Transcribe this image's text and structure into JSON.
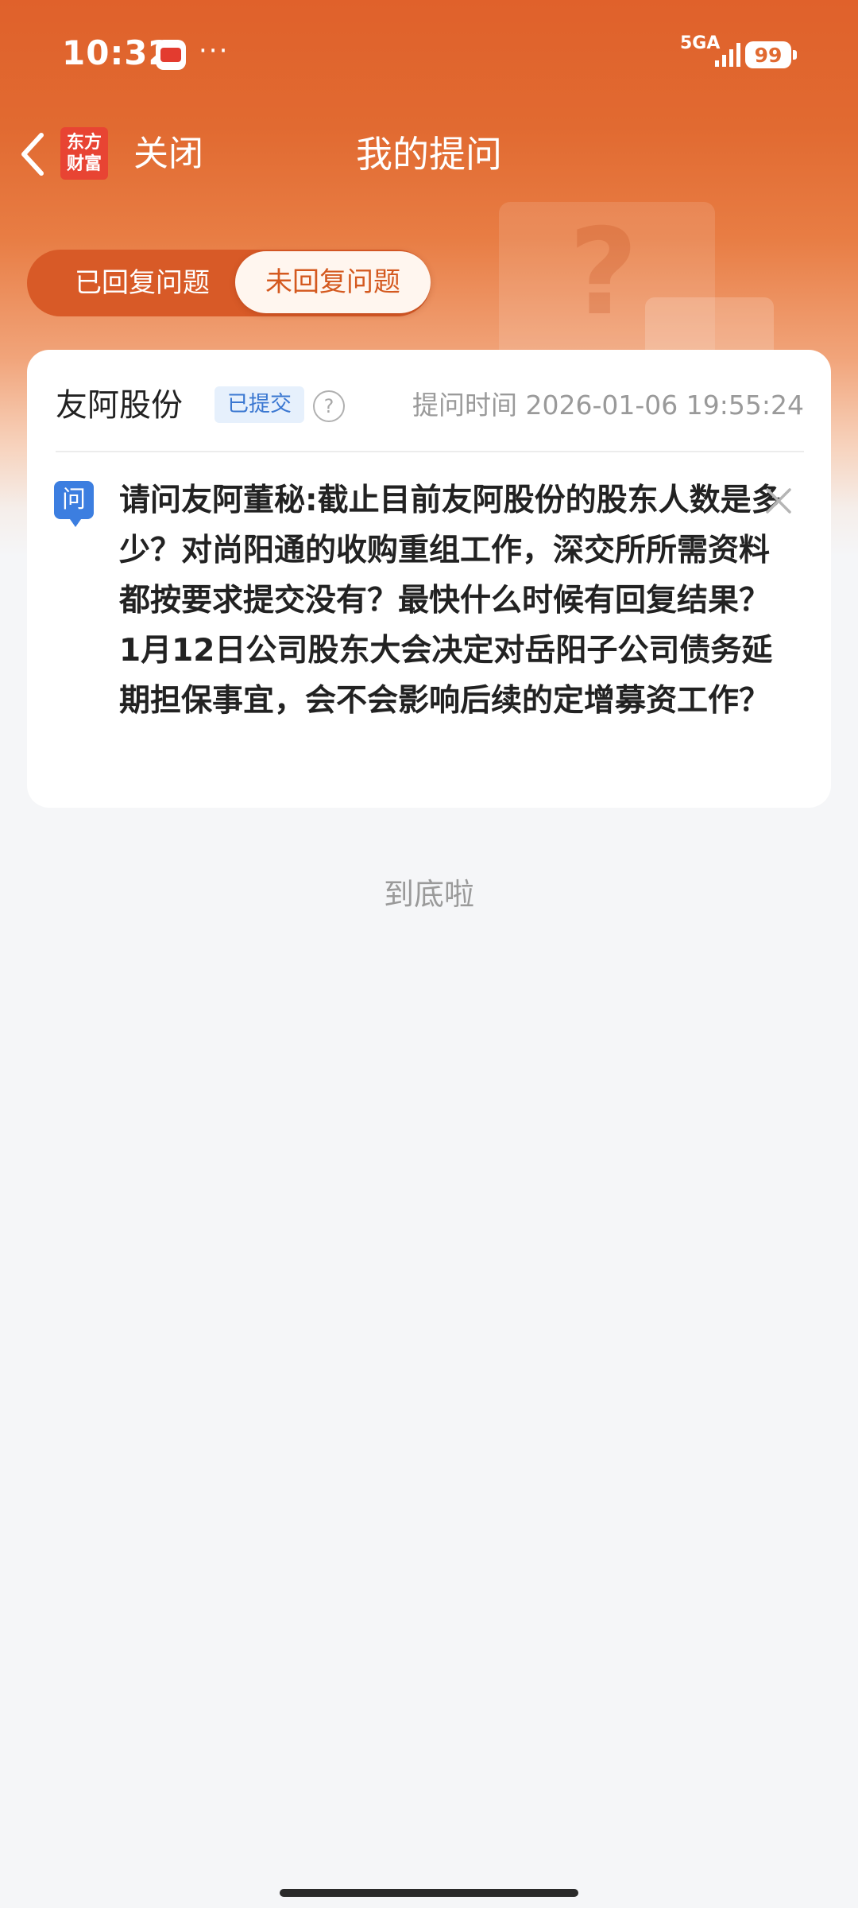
{
  "status_bar": {
    "time": "10:32",
    "more": "···",
    "network": "5GA",
    "battery": "99"
  },
  "nav": {
    "logo_line1": "东方",
    "logo_line2": "财富",
    "close_label": "关闭",
    "title": "我的提问"
  },
  "tabs": {
    "answered": "已回复问题",
    "unanswered": "未回复问题",
    "active": "unanswered"
  },
  "question": {
    "stock_name": "友阿股份",
    "status": "已提交",
    "help": "?",
    "ask_time": "提问时间 2026-01-06 19:55:24",
    "badge": "问",
    "text": "请问友阿董秘:截止目前友阿股份的股东人数是多少？对尚阳通的收购重组工作，深交所所需资料都按要求提交没有？最快什么时候有回复结果？1月12日公司股东大会决定对岳阳子公司债务延期担保事宜，会不会影响后续的定增募资工作？"
  },
  "footer": {
    "end_text": "到底啦"
  },
  "colors": {
    "brand_orange": "#e16a31",
    "badge_blue": "#3c7ee0",
    "status_badge_bg": "#e6f0fc"
  }
}
